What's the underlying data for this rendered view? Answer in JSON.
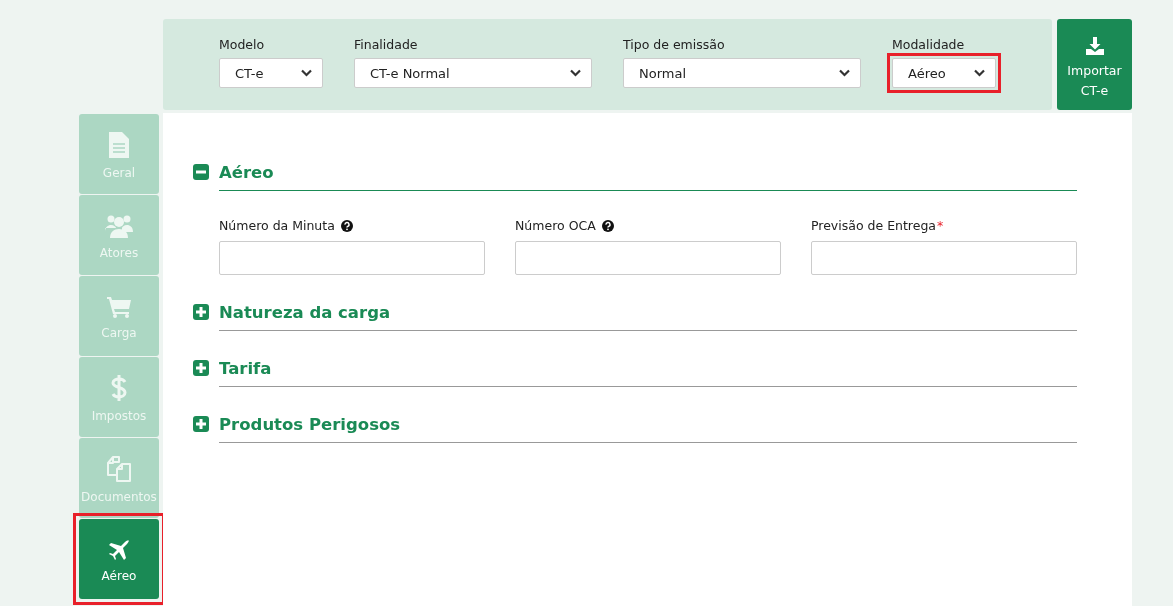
{
  "header": {
    "fields": [
      {
        "label": "Modelo",
        "value": "CT-e",
        "highlighted": false
      },
      {
        "label": "Finalidade",
        "value": "CT-e Normal",
        "highlighted": false
      },
      {
        "label": "Tipo de emissão",
        "value": "Normal",
        "highlighted": false
      },
      {
        "label": "Modalidade",
        "value": "Aéreo",
        "highlighted": true
      }
    ],
    "import_button": {
      "label": "Importar CT-e"
    }
  },
  "sidebar": {
    "tabs": [
      {
        "label": "Geral",
        "selected": false,
        "highlighted": false
      },
      {
        "label": "Atores",
        "selected": false,
        "highlighted": false
      },
      {
        "label": "Carga",
        "selected": false,
        "highlighted": false
      },
      {
        "label": "Impostos",
        "selected": false,
        "highlighted": false
      },
      {
        "label": "Documentos",
        "selected": false,
        "highlighted": false
      },
      {
        "label": "Aéreo",
        "selected": true,
        "highlighted": true
      }
    ]
  },
  "sections": [
    {
      "title": "Aéreo",
      "expanded": true,
      "fields": [
        {
          "label": "Número da Minuta",
          "help": true
        },
        {
          "label": "Número OCA",
          "help": true
        },
        {
          "label": "Previsão de Entrega",
          "help": false,
          "required_mark": "*"
        }
      ]
    },
    {
      "title": "Natureza da carga",
      "expanded": false
    },
    {
      "title": "Tarifa",
      "expanded": false
    },
    {
      "title": "Produtos Perigosos",
      "expanded": false
    }
  ]
}
